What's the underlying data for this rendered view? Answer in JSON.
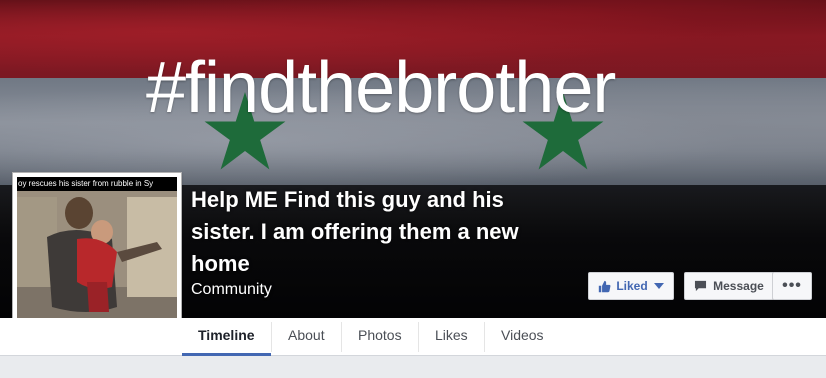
{
  "cover": {
    "hashtag": "#findthebrother",
    "flag_colors": {
      "red": "#8a1a24",
      "white": "#8a909a",
      "black": "#0b0b0d",
      "star": "#1e6b3a"
    }
  },
  "profile": {
    "caption": "oy rescues his sister from rubble in Sy",
    "image_icon": "photo-man-carrying-child"
  },
  "page": {
    "name": "Help ME Find this guy and his sister. I am offering them a new home",
    "category": "Community"
  },
  "actions": {
    "liked_label": "Liked",
    "liked_icon": "thumbs-up-icon",
    "message_label": "Message",
    "message_icon": "speech-bubble-icon",
    "more_label": "•••"
  },
  "tabs": [
    {
      "label": "Timeline",
      "active": true
    },
    {
      "label": "About"
    },
    {
      "label": "Photos"
    },
    {
      "label": "Likes"
    },
    {
      "label": "Videos"
    }
  ],
  "accent_color": "#4267b2"
}
